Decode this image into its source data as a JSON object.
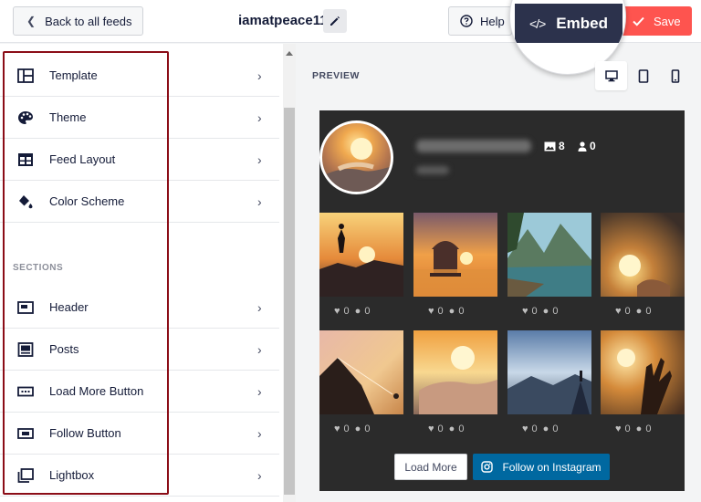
{
  "header": {
    "back_label": "Back to all feeds",
    "feed_name": "iamatpeace11",
    "help_label": "Help",
    "embed_label": "Embed",
    "save_label": "Save"
  },
  "sidebar": {
    "items": [
      {
        "label": "Template",
        "icon": "template-icon"
      },
      {
        "label": "Theme",
        "icon": "palette-icon"
      },
      {
        "label": "Feed Layout",
        "icon": "layout-icon"
      },
      {
        "label": "Color Scheme",
        "icon": "paint-bucket-icon"
      }
    ],
    "sections_label": "SECTIONS",
    "section_items": [
      {
        "label": "Header",
        "icon": "header-icon"
      },
      {
        "label": "Posts",
        "icon": "posts-icon"
      },
      {
        "label": "Load More Button",
        "icon": "load-more-icon"
      },
      {
        "label": "Follow Button",
        "icon": "follow-icon"
      },
      {
        "label": "Lightbox",
        "icon": "lightbox-icon"
      }
    ]
  },
  "preview": {
    "label": "PREVIEW",
    "devices": [
      "desktop-icon",
      "tablet-icon",
      "mobile-icon"
    ],
    "active_device": "desktop",
    "stats": {
      "photos": "8",
      "followers": "0"
    },
    "posts": [
      {
        "likes": "0",
        "comments": "0",
        "scene": "sunset-jump"
      },
      {
        "likes": "0",
        "comments": "0",
        "scene": "temple-sunset"
      },
      {
        "likes": "0",
        "comments": "0",
        "scene": "mountain-lake"
      },
      {
        "likes": "0",
        "comments": "0",
        "scene": "glowing-bulb"
      },
      {
        "likes": "0",
        "comments": "0",
        "scene": "cliff-climb"
      },
      {
        "likes": "0",
        "comments": "0",
        "scene": "hand-sun"
      },
      {
        "likes": "0",
        "comments": "0",
        "scene": "mountain-peak"
      },
      {
        "likes": "0",
        "comments": "0",
        "scene": "hand-sunset"
      }
    ],
    "load_more_label": "Load More",
    "follow_label": "Follow on Instagram"
  },
  "colors": {
    "save": "#fe544f",
    "embed": "#2c324c",
    "follow": "#0068a0",
    "highlight_outline": "#8b0d17",
    "feed_background": "#2b2b2b"
  }
}
